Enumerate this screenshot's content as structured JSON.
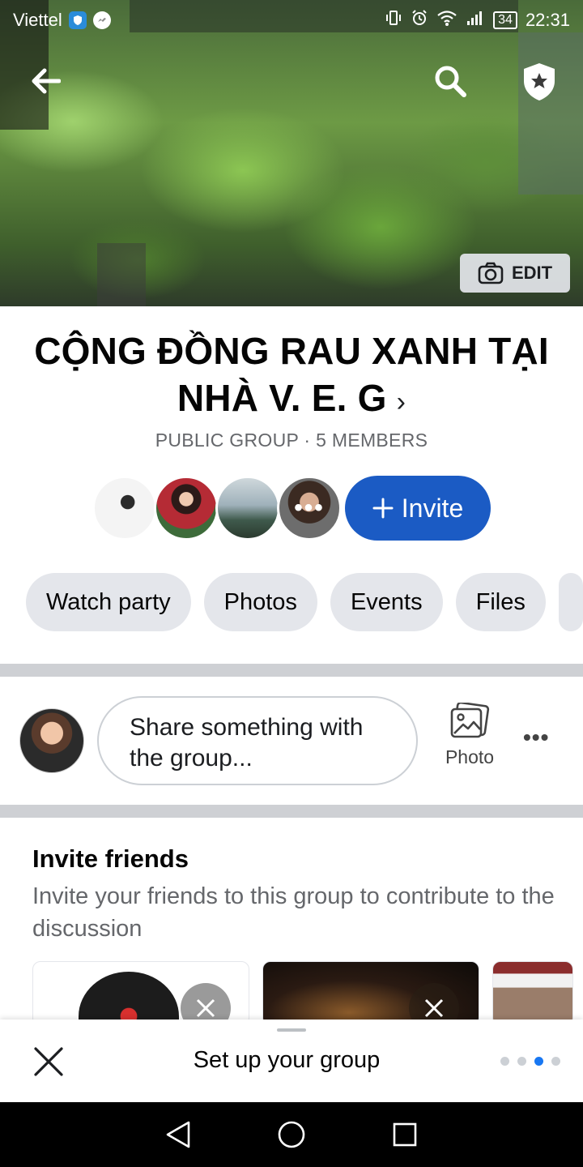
{
  "status_bar": {
    "carrier": "Viettel",
    "battery": "34",
    "time": "22:31"
  },
  "cover": {
    "edit_label": "EDIT"
  },
  "group": {
    "title": "CỘNG ĐỒNG RAU XANH TẠI NHÀ V. E. G",
    "meta": "PUBLIC GROUP · 5 MEMBERS",
    "more_members_label": "•••",
    "invite_label": "Invite"
  },
  "chips": [
    "Watch party",
    "Photos",
    "Events",
    "Files"
  ],
  "composer": {
    "placeholder": "Share something with the group...",
    "photo_label": "Photo"
  },
  "invite_friends": {
    "title": "Invite friends",
    "description": "Invite your friends to this group to contribute to the discussion"
  },
  "setup_sheet": {
    "title": "Set up your group",
    "step_current": 3,
    "step_total": 4
  },
  "colors": {
    "accent": "#1b5bc4",
    "chip_bg": "#e4e6eb",
    "secondary_text": "#65676b"
  }
}
